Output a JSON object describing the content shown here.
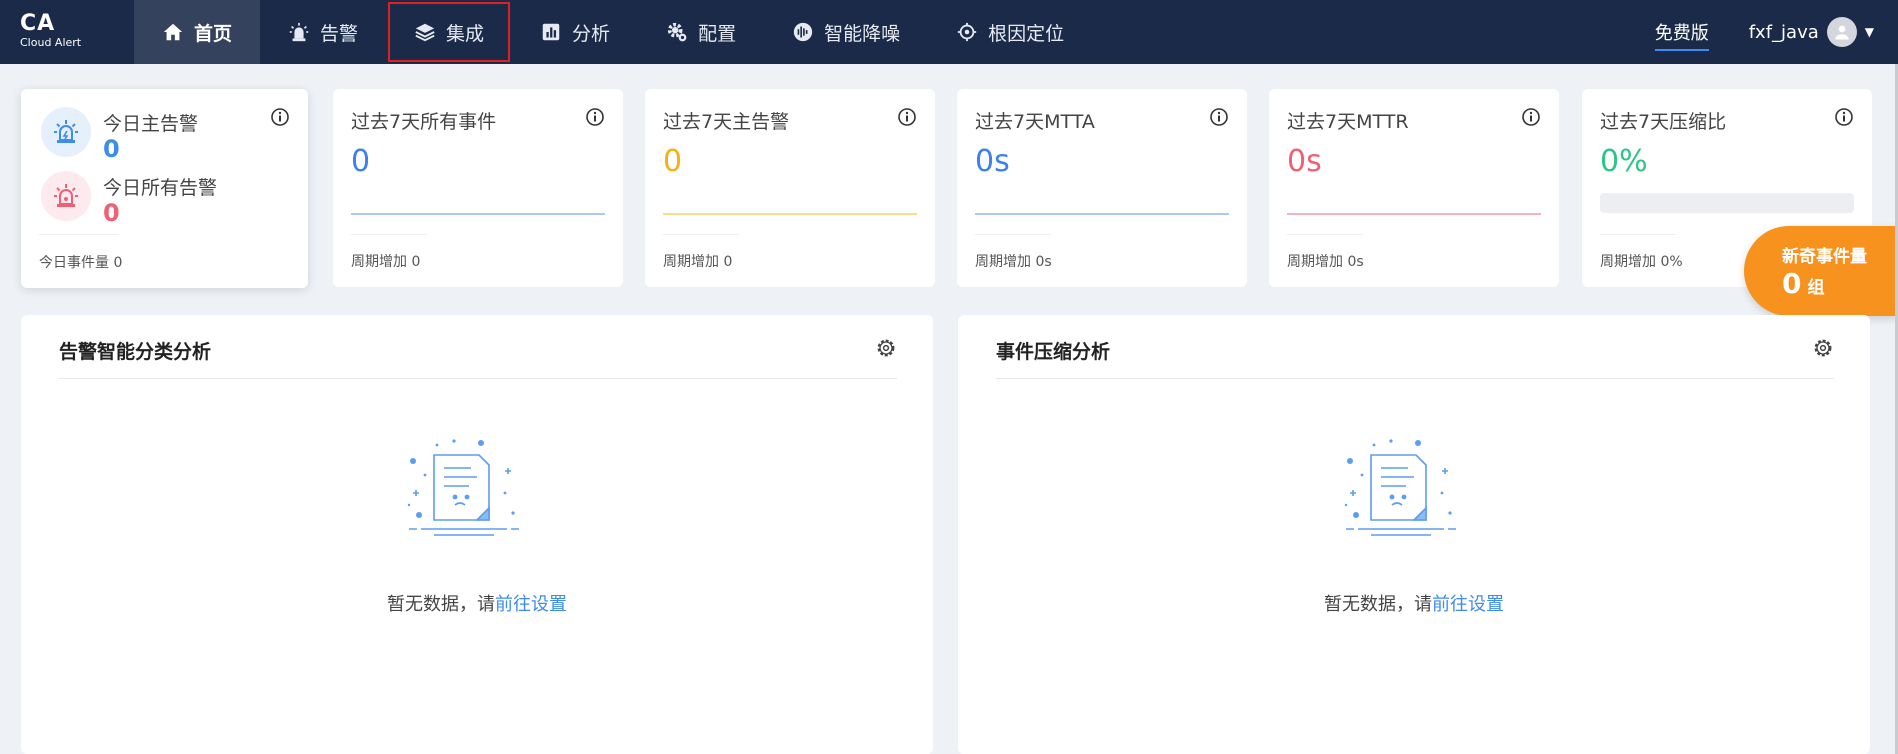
{
  "logo": {
    "title": "CA",
    "subtitle": "Cloud Alert"
  },
  "nav": [
    {
      "label": "首页",
      "icon": "home-icon"
    },
    {
      "label": "告警",
      "icon": "alarm-icon"
    },
    {
      "label": "集成",
      "icon": "layers-icon"
    },
    {
      "label": "分析",
      "icon": "chart-icon"
    },
    {
      "label": "配置",
      "icon": "gear-icon"
    },
    {
      "label": "智能降噪",
      "icon": "noise-icon"
    },
    {
      "label": "根因定位",
      "icon": "target-icon"
    }
  ],
  "header": {
    "plan": "免费版",
    "username": "fxf_java"
  },
  "today": {
    "main_label": "今日主告警",
    "main_value": "0",
    "all_label": "今日所有告警",
    "all_value": "0",
    "footer": "今日事件量 0"
  },
  "stats": [
    {
      "title": "过去7天所有事件",
      "value": "0",
      "footer": "周期增加 0",
      "color": "#3d7ff0"
    },
    {
      "title": "过去7天主告警",
      "value": "0",
      "footer": "周期增加 0",
      "color": "#f5b014"
    },
    {
      "title": "过去7天MTTA",
      "value": "0s",
      "footer": "周期增加 0s",
      "color": "#3d7ff0"
    },
    {
      "title": "过去7天MTTR",
      "value": "0s",
      "footer": "周期增加 0s",
      "color": "#f06074"
    },
    {
      "title": "过去7天压缩比",
      "value": "0%",
      "footer": "周期增加 0%",
      "color": "#2ec488"
    }
  ],
  "badge": {
    "title": "新奇事件量",
    "value": "0",
    "unit": "组"
  },
  "panels": [
    {
      "title": "告警智能分类分析",
      "empty_text": "暂无数据，请",
      "link": "前往设置"
    },
    {
      "title": "事件压缩分析",
      "empty_text": "暂无数据，请",
      "link": "前往设置"
    }
  ],
  "colors": {
    "nav_bg": "#1b2a48",
    "nav_active": "#34425e",
    "accent": "#3d8cf0",
    "badge": "#f7921e",
    "alert_blue": "#3d8cf0",
    "alert_red": "#f06074"
  }
}
